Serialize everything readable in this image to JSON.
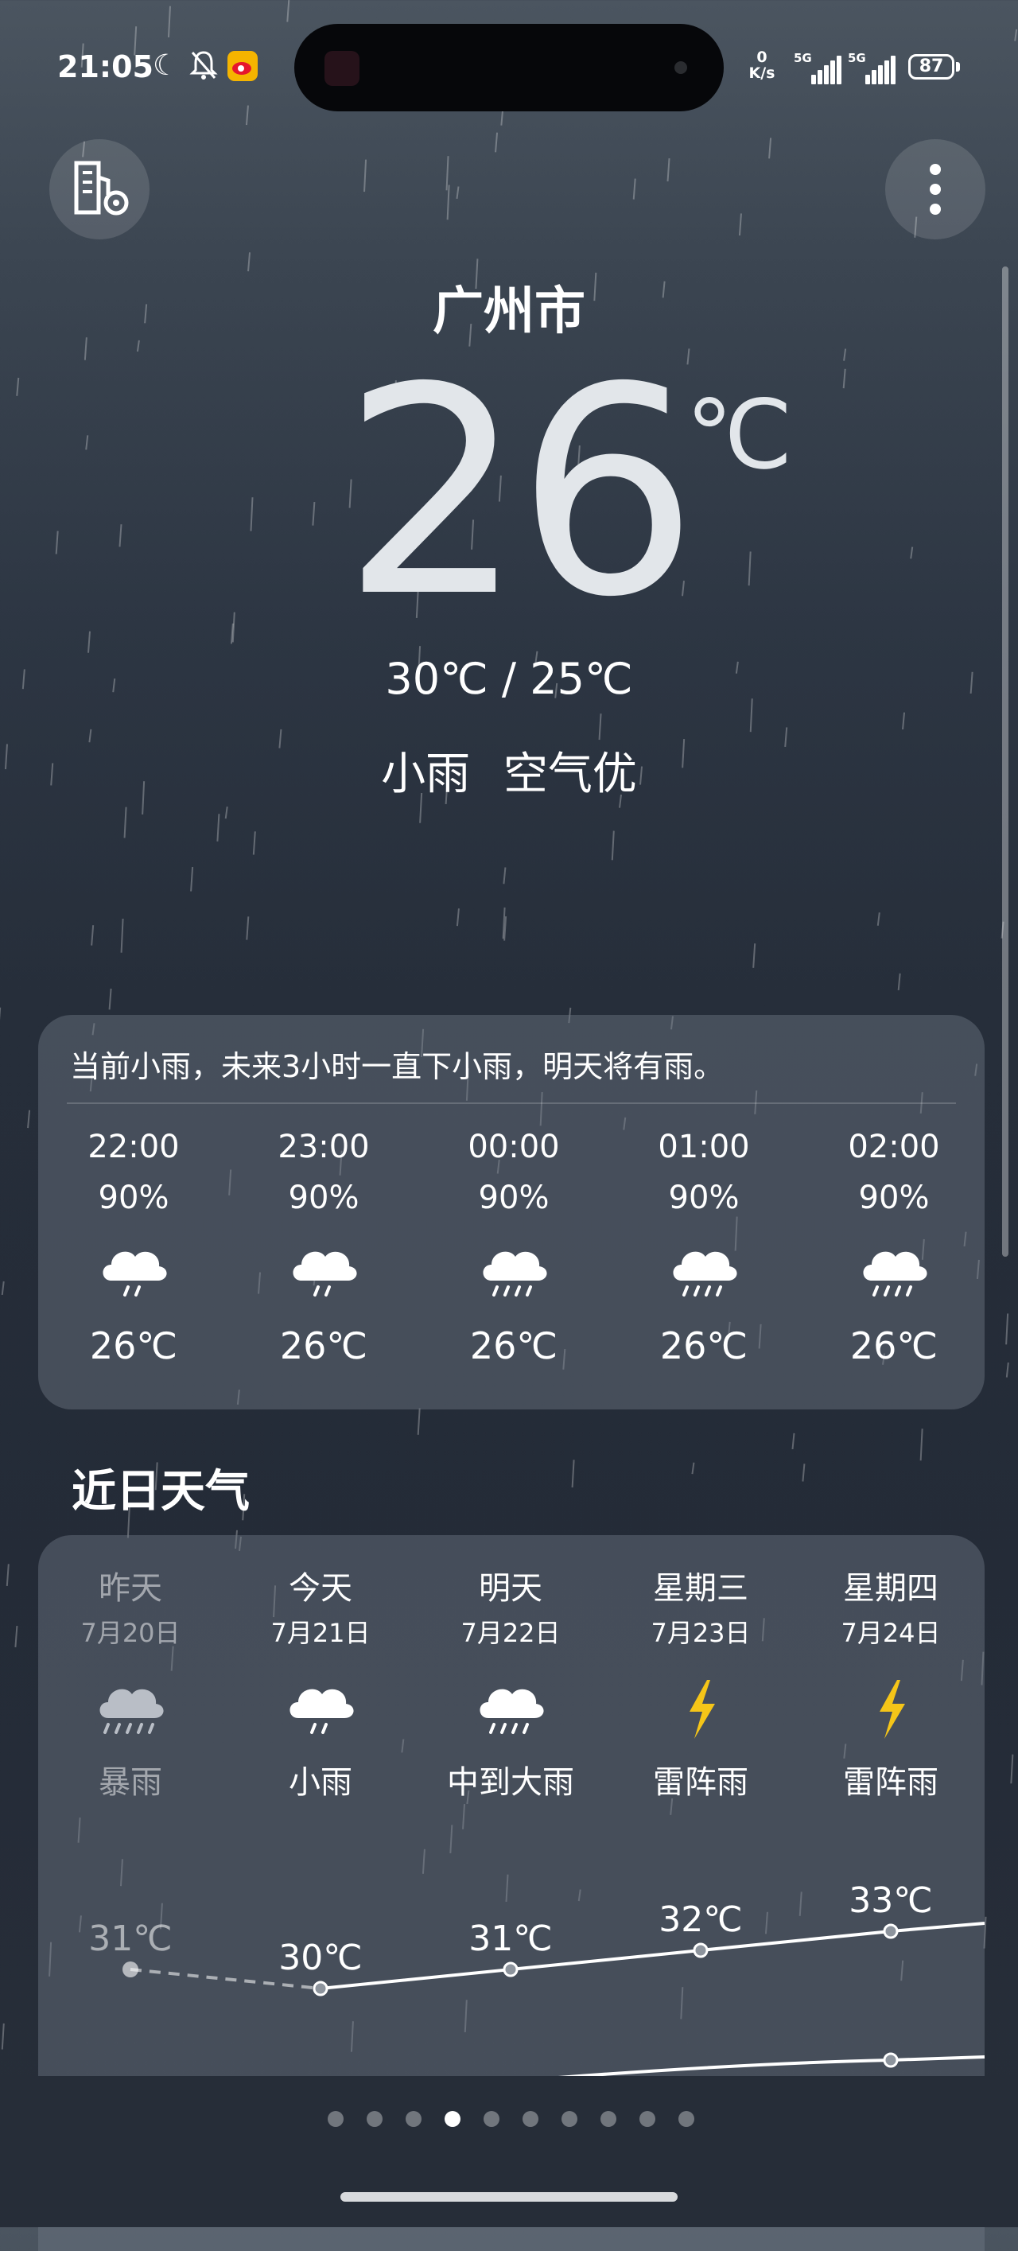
{
  "status_bar": {
    "time": "21:05",
    "net_speed_value": "0",
    "net_speed_unit": "K/s",
    "sim1": "5G",
    "sim2": "5G",
    "battery": "87"
  },
  "current": {
    "city": "广州市",
    "temperature": "26",
    "unit": "℃",
    "range": "30℃ / 25℃",
    "condition": "小雨",
    "air_quality": "空气优"
  },
  "hourly": {
    "alert": "当前小雨，未来3小时一直下小雨，明天将有雨。",
    "items": [
      {
        "time": "22:00",
        "precip": "90%",
        "icon": "light-rain-icon",
        "temp": "26℃"
      },
      {
        "time": "23:00",
        "precip": "90%",
        "icon": "light-rain-icon",
        "temp": "26℃"
      },
      {
        "time": "00:00",
        "precip": "90%",
        "icon": "moderate-rain-icon",
        "temp": "26℃"
      },
      {
        "time": "01:00",
        "precip": "90%",
        "icon": "moderate-rain-icon",
        "temp": "26℃"
      },
      {
        "time": "02:00",
        "precip": "90%",
        "icon": "moderate-rain-icon",
        "temp": "26℃"
      }
    ]
  },
  "daily": {
    "title": "近日天气",
    "items": [
      {
        "name": "昨天",
        "date": "7月20日",
        "icon": "heavy-rain-icon",
        "weather": "暴雨",
        "high": "31℃"
      },
      {
        "name": "今天",
        "date": "7月21日",
        "icon": "light-rain-icon",
        "weather": "小雨",
        "high": "30℃"
      },
      {
        "name": "明天",
        "date": "7月22日",
        "icon": "moderate-rain-icon",
        "weather": "中到大雨",
        "high": "31℃"
      },
      {
        "name": "星期三",
        "date": "7月23日",
        "icon": "thunderstorm-icon",
        "weather": "雷阵雨",
        "high": "32℃"
      },
      {
        "name": "星期四",
        "date": "7月24日",
        "icon": "thunderstorm-icon",
        "weather": "雷阵雨",
        "high": "33℃"
      }
    ]
  },
  "chart_data": {
    "type": "line",
    "categories": [
      "7月20日",
      "7月21日",
      "7月22日",
      "7月23日",
      "7月24日"
    ],
    "series": [
      {
        "values": [
          31,
          30,
          31,
          32,
          33
        ]
      }
    ]
  },
  "page_indicator": {
    "count": 10,
    "active_index": 3
  },
  "colors": {
    "accent_lightning": "#f5c518",
    "card": "#5b6470"
  }
}
